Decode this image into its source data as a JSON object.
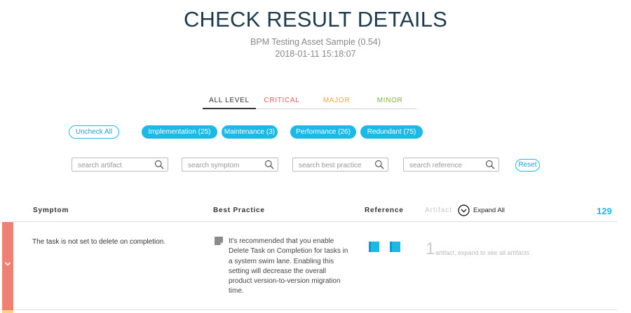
{
  "header": {
    "title": "CHECK RESULT DETAILS",
    "asset_name": "BPM Testing Asset Sample (0.54)",
    "timestamp": "2018-01-11 15:18:07"
  },
  "levels": {
    "all": "ALL LEVEL",
    "critical": "CRITICAL",
    "major": "MAJOR",
    "minor": "MINOR",
    "selected": "ALL LEVEL"
  },
  "filters": {
    "uncheck_all": "Uncheck All",
    "categories": [
      "Implementation (25)",
      "Maintenance (3)",
      "Performance (26)",
      "Redundant (75)"
    ]
  },
  "search": {
    "artifact_placeholder": "search artifact",
    "symptom_placeholder": "search symptom",
    "best_practice_placeholder": "search best practice",
    "reference_placeholder": "search reference",
    "reset_label": "Reset"
  },
  "table": {
    "columns": {
      "symptom": "Symptom",
      "best_practice": "Best Practice",
      "reference": "Reference",
      "artifact": "Artifact"
    },
    "expand_all": "Expand All",
    "total_count": "129",
    "rows": [
      {
        "symptom": "The task is not set to delete on completion.",
        "best_practice": "It's recommended that you enable Delete Task on Completion for tasks in a system swim lane. Enabling this setting will decrease the overall product version-to-version migration time.",
        "artifact_count": "1",
        "artifact_text": "artifact, expand to see all artifacts",
        "severity_color": "#f08074"
      }
    ]
  },
  "colors": {
    "accent": "#1bb9e6",
    "title": "#1b3a4b",
    "critical": "#e35d5d",
    "major": "#f0a73a",
    "minor": "#7fb23a"
  },
  "icons": {
    "search": "magnifier-icon",
    "expand": "chevron-circle-icon",
    "row_toggle": "chevron-down-icon",
    "best_practice": "document-icon",
    "reference": "book-icon"
  }
}
